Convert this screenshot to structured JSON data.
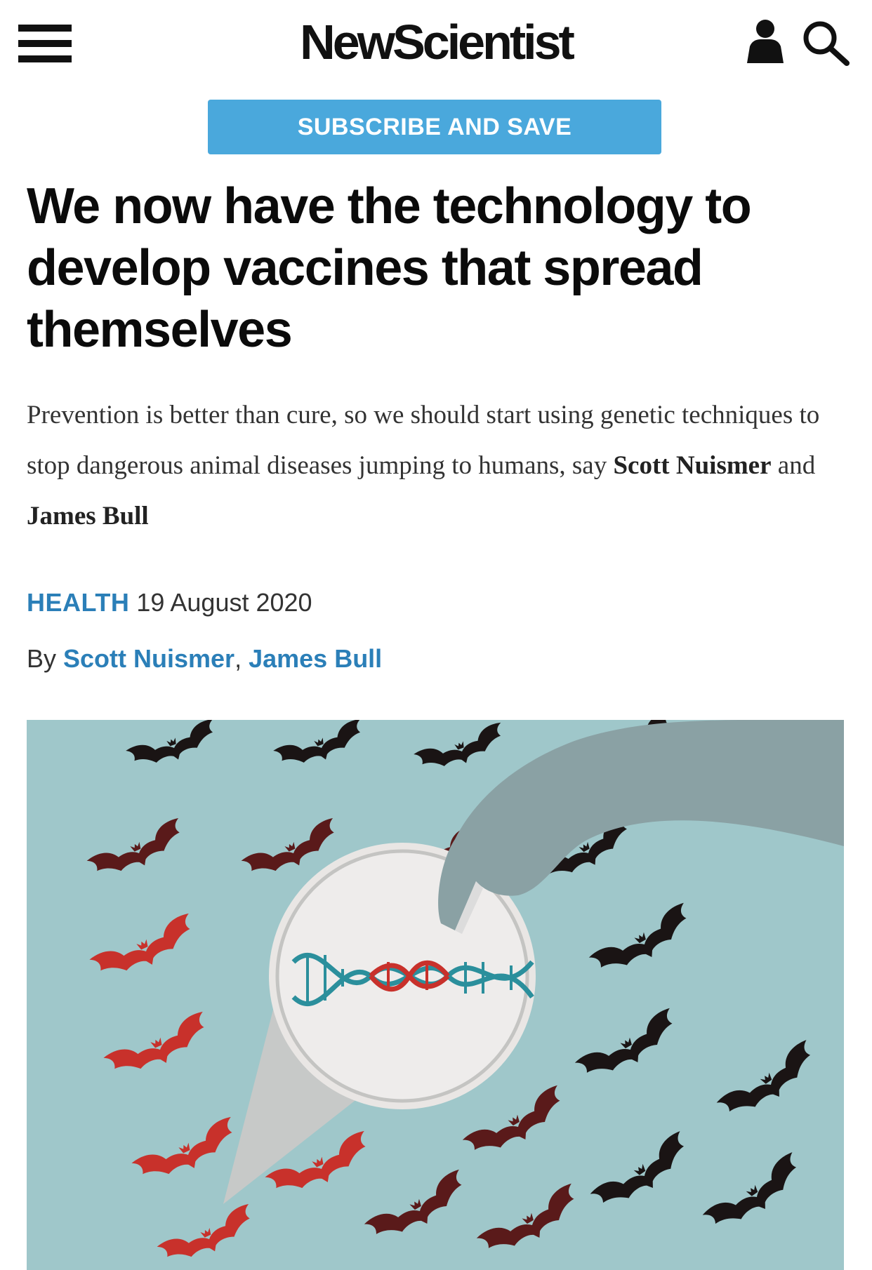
{
  "header": {
    "logo": "NewScientist",
    "menu_icon": "hamburger-menu-icon",
    "user_icon": "user-account-icon",
    "search_icon": "search-icon"
  },
  "subscribe": {
    "label": "SUBSCRIBE AND SAVE"
  },
  "article": {
    "title": "We now have the technology to develop vaccines that spread themselves",
    "standfirst_text": "Prevention is better than cure, so we should start using genetic techniques to stop dangerous animal diseases jumping to humans, say ",
    "standfirst_author1": "Scott Nuismer",
    "standfirst_and": " and ",
    "standfirst_author2": "James Bull",
    "section": "HEALTH",
    "date": "19 August 2020",
    "by_label": "By ",
    "authors": [
      "Scott Nuismer",
      "James Bull"
    ],
    "author_separator": ", "
  },
  "colors": {
    "accent": "#4aa8dc",
    "link": "#2b7fb8",
    "image_background": "#9fc7ca",
    "bat_black": "#1a1414",
    "bat_dark_red": "#5a1a1a",
    "bat_red": "#c8312b"
  }
}
